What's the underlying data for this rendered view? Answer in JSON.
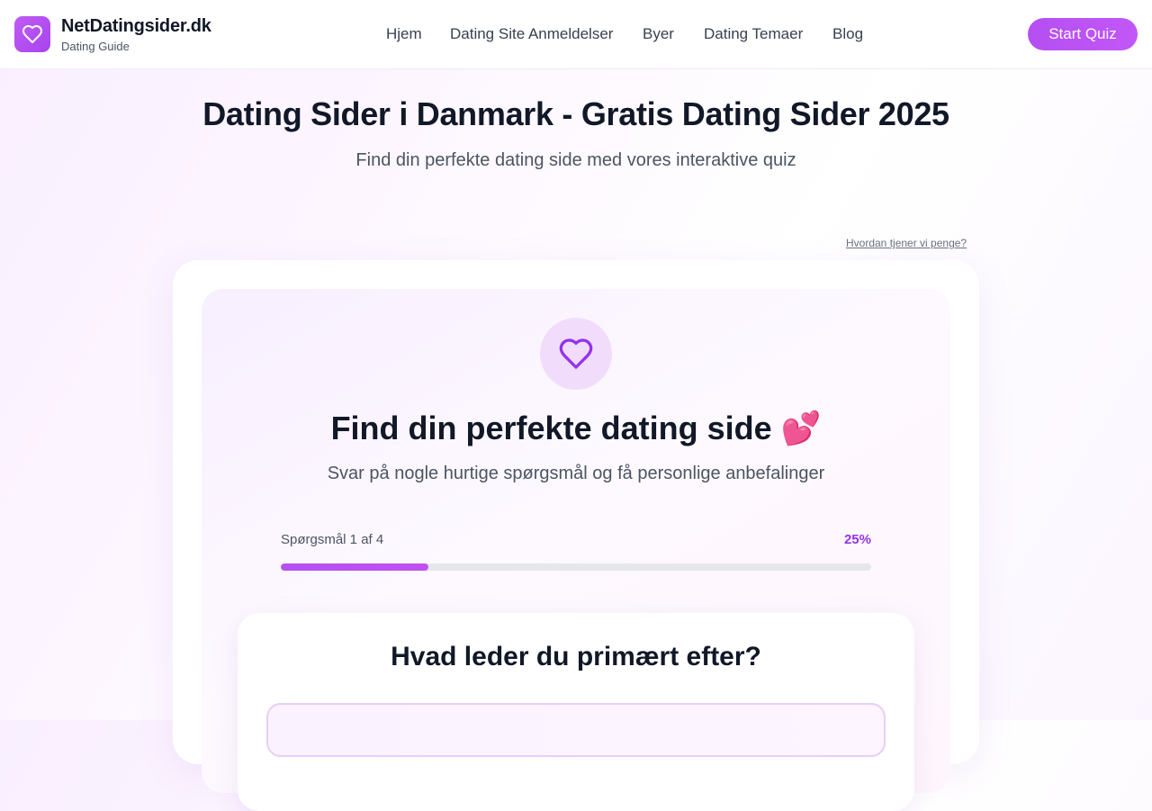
{
  "header": {
    "brand_name": "NetDatingsider.dk",
    "brand_tagline": "Dating Guide",
    "nav": [
      {
        "label": "Hjem"
      },
      {
        "label": "Dating Site Anmeldelser"
      },
      {
        "label": "Byer"
      },
      {
        "label": "Dating Temaer"
      },
      {
        "label": "Blog"
      }
    ],
    "cta_label": "Start Quiz"
  },
  "hero": {
    "title": "Dating Sider i Danmark - Gratis Dating Sider 2025",
    "subtitle": "Find din perfekte dating side med vores interaktive quiz"
  },
  "money_link": "Hvordan tjener vi penge?",
  "quiz": {
    "title": "Find din perfekte dating side 💕",
    "subtitle": "Svar på nogle hurtige spørgsmål og få personlige anbefalinger",
    "progress_label": "Spørgsmål 1 af 4",
    "progress_percent_label": "25%",
    "progress_fraction": 0.25,
    "question": "Hvad leder du primært efter?"
  },
  "colors": {
    "accent": "#b54ff2",
    "accent_text": "#9333ea"
  },
  "icons": {
    "logo": "heart-icon",
    "quiz": "heart-icon"
  }
}
